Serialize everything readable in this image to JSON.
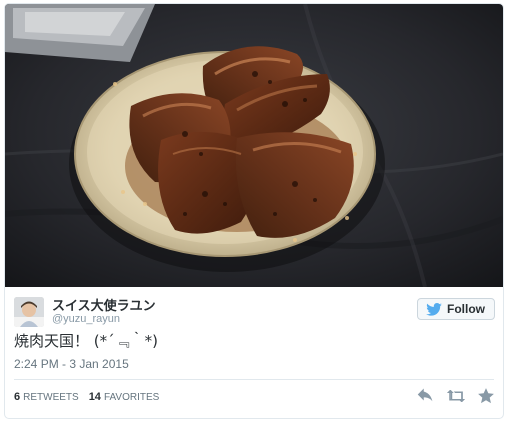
{
  "user": {
    "display_name": "スイス大使ラユン",
    "handle": "@yuzu_rayun"
  },
  "follow_button": {
    "label": "Follow",
    "icon": "twitter-bird-icon"
  },
  "tweet": {
    "text": "焼肉天国！ (*´﹃｀*)",
    "timestamp": "2:24 PM - 3 Jan 2015"
  },
  "stats": {
    "retweets_count": "6",
    "retweets_label": "RETWEETS",
    "favorites_count": "14",
    "favorites_label": "FAVORITES"
  },
  "actions": [
    "reply-icon",
    "retweet-icon",
    "favorite-icon"
  ],
  "colors": {
    "twitter_blue": "#55acee",
    "text_dark": "#292f33",
    "text_muted": "#8899a6",
    "border": "#e1e8ed",
    "action_icon": "#8899a6"
  }
}
